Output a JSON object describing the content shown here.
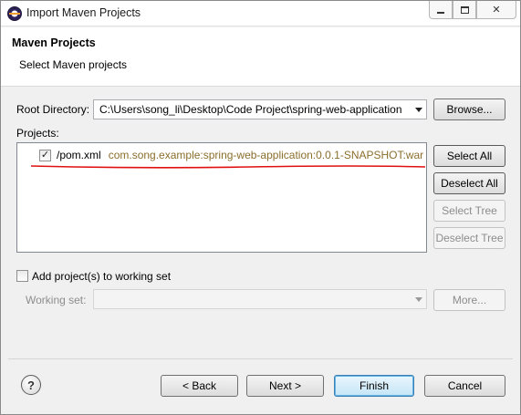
{
  "window": {
    "title": "Import Maven Projects"
  },
  "header": {
    "title": "Maven Projects",
    "description": "Select Maven projects"
  },
  "root_directory": {
    "label": "Root Directory:",
    "value": "C:\\Users\\song_li\\Desktop\\Code Project\\spring-web-application",
    "browse_label": "Browse..."
  },
  "projects": {
    "label": "Projects:",
    "items": [
      {
        "path": "/pom.xml",
        "gav": "com.song.example:spring-web-application:0.0.1-SNAPSHOT:war",
        "checked": true
      }
    ],
    "select_all": "Select All",
    "deselect_all": "Deselect All",
    "select_tree": "Select Tree",
    "deselect_tree": "Deselect Tree"
  },
  "working_set": {
    "checkbox_label": "Add project(s) to working set",
    "label": "Working set:",
    "value": "",
    "more_label": "More..."
  },
  "footer": {
    "back": "< Back",
    "next": "Next >",
    "finish": "Finish",
    "cancel": "Cancel"
  },
  "icons": {
    "app": "eclipse-icon",
    "help": "help-icon",
    "annotation": "red-underline"
  },
  "colors": {
    "gav_text": "#8b6e2c",
    "annotation": "#e01010",
    "default_button": "#3c7fb1"
  }
}
